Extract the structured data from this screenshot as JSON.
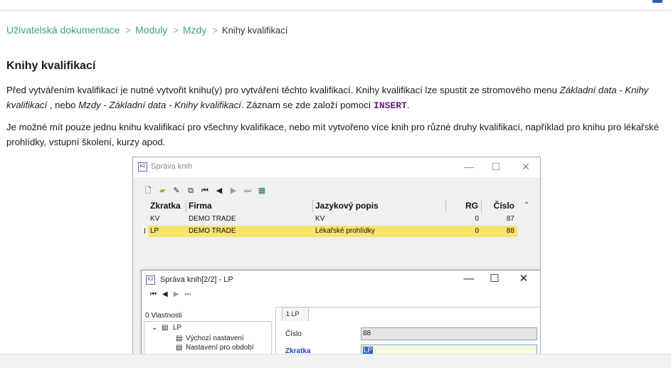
{
  "breadcrumb": {
    "items": [
      "Uživatelská dokumentace",
      "Moduly",
      "Mzdy"
    ],
    "current": "Knihy kvalifikací",
    "separator": ">"
  },
  "page_title": "Knihy kvalifikací",
  "paragraph1": {
    "t1": "Před vytvářením kvalifikací je nutné vytvořit knihu(y) pro vytváření těchto kvalifikací. Knihy kvalifikací lze spustit ze stromového menu ",
    "i1": "Základní data - Knihy kvalifikací",
    "t2": " , nebo ",
    "i2": "Mzdy - Základní data - Knihy kvalifikací",
    "t3": ". Záznam se zde založí pomocí ",
    "keyword": "INSERT",
    "t4": "."
  },
  "paragraph2": "Je možné mít pouze jednu knihu kvalifikací pro všechny kvalifikace, nebo mít vytvořeno více knih pro různé druhy kvalifikací, například pro knihu pro lékařské prohlídky, vstupní školení, kurzy apod.",
  "window": {
    "title": "Správa knih",
    "app_icon_text": "K2",
    "controls": [
      "—",
      "☐",
      "✕"
    ],
    "toolbar_icons": [
      "new-document-icon",
      "open-folder-icon",
      "edit-icon",
      "copy-icon",
      "first-record-icon",
      "previous-record-icon",
      "next-record-icon",
      "last-record-icon",
      "excel-export-icon"
    ],
    "grid": {
      "columns": [
        "Zkratka",
        "Firma",
        "Jazykový popis",
        "RG",
        "Číslo"
      ],
      "rows": [
        {
          "zkratka": "KV",
          "firma": "DEMO TRADE",
          "popis": "KV",
          "rg": "0",
          "cislo": "87",
          "selected": false
        },
        {
          "zkratka": "LP",
          "firma": "DEMO TRADE",
          "popis": "Lékařské prohlídky",
          "rg": "0",
          "cislo": "88",
          "selected": true
        }
      ]
    }
  },
  "dialog": {
    "title": "Správa knih[2/2] - LP",
    "app_icon_text": "K2",
    "controls": [
      "—",
      "☐",
      "✕"
    ],
    "tree_label": "0 Vlastnosti",
    "tree": [
      "LP",
      "Výchozí nastavení",
      "Nastavení pro období"
    ],
    "tab": "1 LP",
    "fields": [
      {
        "label": "Číslo",
        "value": "88",
        "bold": false
      },
      {
        "label": "Zkratka",
        "value": "LP",
        "bold": true
      }
    ]
  },
  "colors": {
    "link": "#3fa37c",
    "selected_row": "#f7e36b",
    "keyword": "#6a1b7a",
    "field_label_bold": "#1f3fb5"
  }
}
